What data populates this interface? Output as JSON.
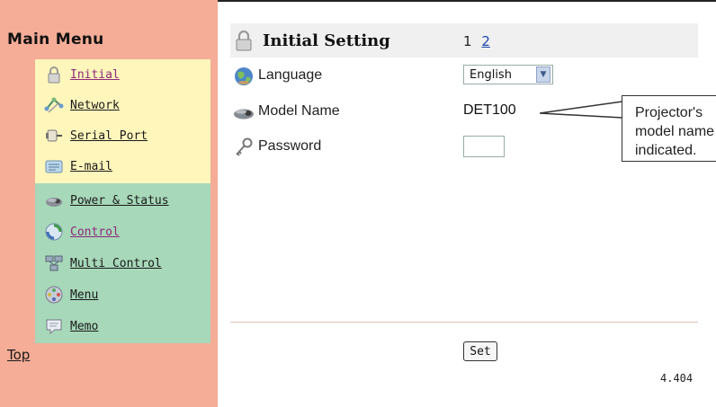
{
  "sidebar": {
    "title": "Main Menu",
    "items": [
      {
        "label": "Initial",
        "icon": "lock-icon",
        "visited": true
      },
      {
        "label": "Network",
        "icon": "network-icon",
        "visited": false
      },
      {
        "label": "Serial Port",
        "icon": "serial-port-icon",
        "visited": false
      },
      {
        "label": "E-mail",
        "icon": "email-icon",
        "visited": false
      },
      {
        "label": "Power & Status",
        "icon": "projector-icon",
        "visited": false
      },
      {
        "label": "Control",
        "icon": "control-icon",
        "visited": true
      },
      {
        "label": "Multi Control",
        "icon": "multi-control-icon",
        "visited": false
      },
      {
        "label": "Menu",
        "icon": "menu-icon",
        "visited": false
      },
      {
        "label": "Memo",
        "icon": "memo-icon",
        "visited": false
      }
    ],
    "top_link": "Top"
  },
  "main": {
    "title": "Initial Setting",
    "page_current": "1",
    "page_link": "2",
    "language_label": "Language",
    "language_value": "English",
    "model_label": "Model Name",
    "model_value": "DET100",
    "password_label": "Password",
    "password_value": "",
    "set_label": "Set",
    "version": "4.404"
  },
  "callout": {
    "line1": "Projector's",
    "line2": "model name is",
    "line3": "indicated."
  },
  "colors": {
    "sidebar_bg": "#f5ad97",
    "group_yellow": "#fff6bc",
    "group_green": "#a7d8b9",
    "visited_link": "#8d2a7a",
    "page_link": "#1f47a8"
  }
}
